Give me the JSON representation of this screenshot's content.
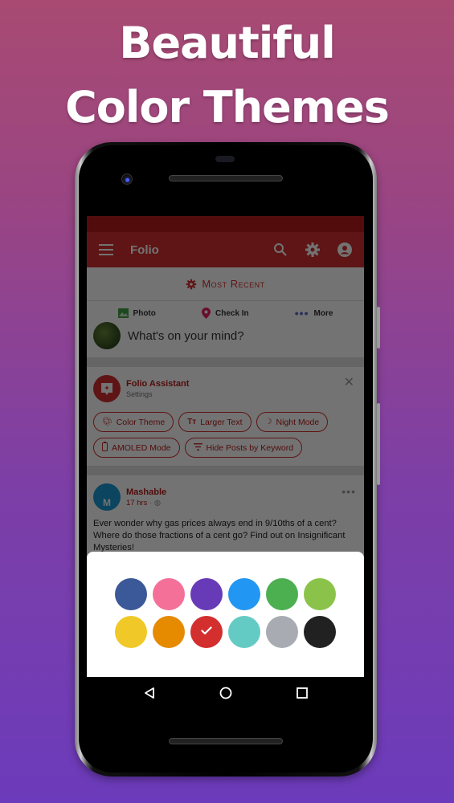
{
  "headline": {
    "line1": "Beautiful",
    "line2": "Color Themes"
  },
  "app": {
    "title": "Folio",
    "accent": "#d32f2f",
    "icons": [
      "menu-icon",
      "search-icon",
      "gear-icon",
      "account-icon"
    ]
  },
  "feed_header": {
    "label": "Most Recent",
    "icon": "gear-icon"
  },
  "composer": {
    "actions": [
      {
        "label": "Photo",
        "icon": "photo-icon"
      },
      {
        "label": "Check In",
        "icon": "location-pin-icon"
      },
      {
        "label": "More",
        "icon": "more-dots-icon"
      }
    ],
    "placeholder": "What's on your mind?"
  },
  "assistant": {
    "name": "Folio Assistant",
    "subtitle": "Settings",
    "chips": [
      {
        "label": "Color Theme",
        "icon": "palette-icon"
      },
      {
        "label": "Larger Text",
        "icon": "text-size-icon"
      },
      {
        "label": "Night Mode",
        "icon": "moon-icon"
      },
      {
        "label": "AMOLED Mode",
        "icon": "battery-icon"
      },
      {
        "label": "Hide Posts by Keyword",
        "icon": "filter-icon"
      }
    ]
  },
  "post": {
    "author": "Mashable",
    "avatar_letter": "M",
    "time": "17 hrs",
    "body": "Ever wonder why gas prices always end in 9/10ths of a cent? Where do those fractions of a cent go? Find out on Insignificant Mysteries!"
  },
  "theme_picker": {
    "selected_index": 8,
    "colors": [
      {
        "name": "indigo",
        "hex": "#3b5998"
      },
      {
        "name": "pink",
        "hex": "#f57099"
      },
      {
        "name": "purple",
        "hex": "#673ab7"
      },
      {
        "name": "blue",
        "hex": "#2196f3"
      },
      {
        "name": "green",
        "hex": "#4caf50"
      },
      {
        "name": "light-green",
        "hex": "#8bc34a"
      },
      {
        "name": "yellow",
        "hex": "#f0c929"
      },
      {
        "name": "orange",
        "hex": "#e68a00"
      },
      {
        "name": "red",
        "hex": "#d32f2f"
      },
      {
        "name": "teal",
        "hex": "#64cbc4"
      },
      {
        "name": "grey",
        "hex": "#a9abb2"
      },
      {
        "name": "black",
        "hex": "#212121"
      }
    ]
  },
  "navbar": [
    "back-icon",
    "home-icon",
    "recents-icon"
  ]
}
